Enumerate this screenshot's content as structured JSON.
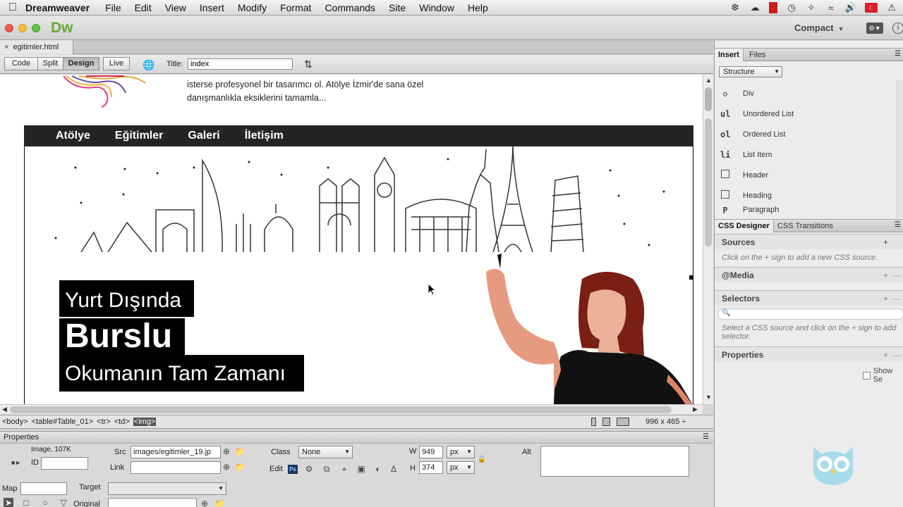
{
  "menubar": {
    "app": "Dreamweaver",
    "items": [
      "File",
      "Edit",
      "View",
      "Insert",
      "Modify",
      "Format",
      "Commands",
      "Site",
      "Window",
      "Help"
    ]
  },
  "appbar": {
    "logo": "Dw",
    "workspace": "Compact"
  },
  "document": {
    "tab_name": "egitimler.html",
    "views": [
      "Code",
      "Split",
      "Design",
      "Live"
    ],
    "active_view": "Design",
    "title_label": "Title:",
    "title_value": "index"
  },
  "page": {
    "intro_line1": "isterse profesyonel bir tasarımcı ol. Atölye İzmir'de sana özel",
    "intro_line2": "danışmanlıkla eksiklerini tamamla...",
    "nav": [
      "Atölye",
      "Eğitimler",
      "Galeri",
      "İletişim"
    ],
    "promo_line1": "Yurt Dışında",
    "promo_line2": "Burslu",
    "promo_line3": "Okumanın Tam Zamanı"
  },
  "status": {
    "breadcrumbs": [
      "<body>",
      "<table#Table_01>",
      "<tr>",
      "<td>",
      "<img>"
    ],
    "selected_tag": "<img>",
    "dimensions": "996 x 465 ÷"
  },
  "properties": {
    "header": "Properties",
    "element_type": "Image, 107K",
    "id_label": "ID",
    "src_label": "Src",
    "src_value": "images/egitimler_19.jp",
    "link_label": "Link",
    "link_value": "",
    "class_label": "Class",
    "class_value": "None",
    "edit_label": "Edit",
    "ps_label": "Ps",
    "w_label": "W",
    "w_value": "949",
    "h_label": "H",
    "h_value": "374",
    "unit": "px",
    "alt_label": "Alt",
    "map_label": "Map",
    "target_label": "Target",
    "original_label": "Original"
  },
  "insert_panel": {
    "tabs": [
      "Insert",
      "Files"
    ],
    "category": "Structure",
    "items": [
      {
        "icon": "<>",
        "label": "Div"
      },
      {
        "icon": "ul",
        "label": "Unordered List"
      },
      {
        "icon": "ol",
        "label": "Ordered List"
      },
      {
        "icon": "li",
        "label": "List Item"
      },
      {
        "icon": "box",
        "label": "Header"
      },
      {
        "icon": "box",
        "label": "Heading"
      },
      {
        "icon": "P",
        "label": "Paragraph"
      }
    ]
  },
  "css_panel": {
    "tabs": [
      "CSS Designer",
      "CSS Transitions"
    ],
    "sources": "Sources",
    "sources_hint": "Click on the + sign to add a new CSS source.",
    "media": "@Media",
    "selectors": "Selectors",
    "selectors_hint1": "Select a CSS source and click on the + sign to add",
    "selectors_hint2": "selector.",
    "properties": "Properties",
    "show_set": "Show Se"
  },
  "colors": {
    "dw_green": "#6aa639",
    "nav_bg": "#242424",
    "woman_shirt": "#111111",
    "owl": "#a6dcea"
  }
}
